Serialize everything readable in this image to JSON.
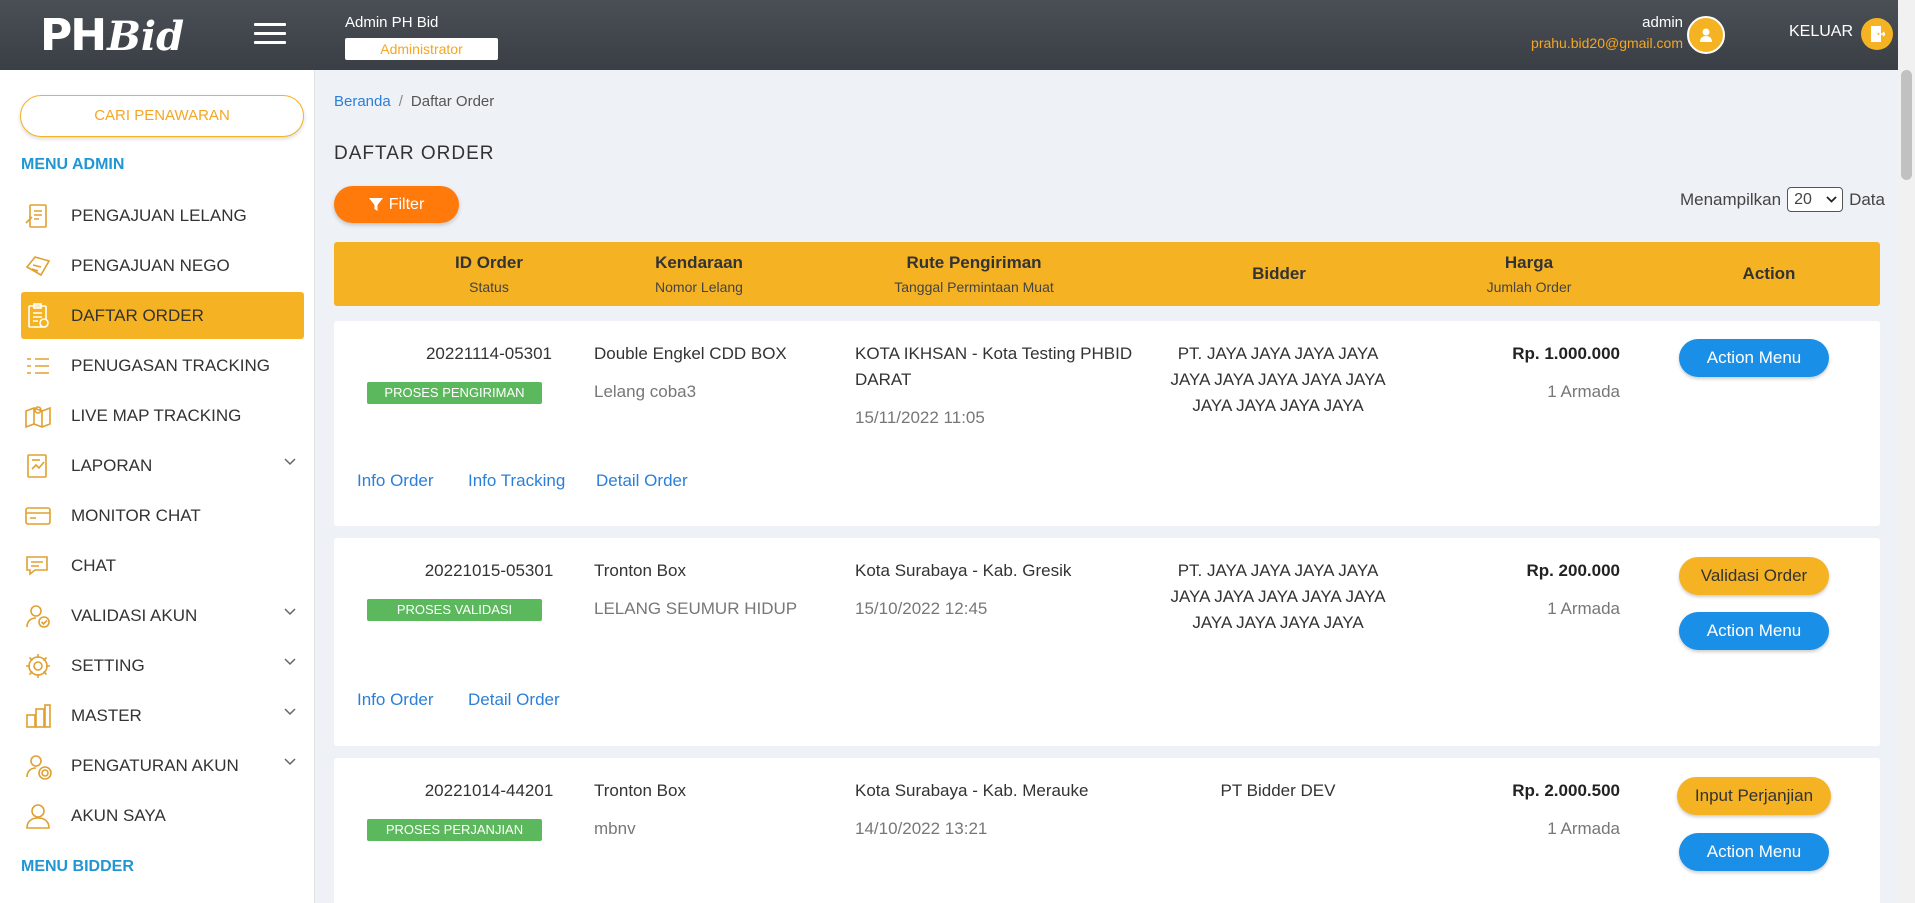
{
  "brand": {
    "logo_ph": "PH",
    "logo_bid": "Bid"
  },
  "header": {
    "admin_name": "Admin PH Bid",
    "role": "Administrator",
    "user_name": "admin",
    "user_email": "prahu.bid20@gmail.com",
    "logout_label": "KELUAR"
  },
  "sidebar": {
    "search_button": "CARI PENAWARAN",
    "menu_admin_title": "MENU ADMIN",
    "menu_bidder_title": "MENU BIDDER",
    "items": [
      {
        "label": "PENGAJUAN LELANG",
        "icon": "auction-request-icon"
      },
      {
        "label": "PENGAJUAN NEGO",
        "icon": "nego-request-icon"
      },
      {
        "label": "DAFTAR ORDER",
        "icon": "order-list-icon",
        "active": true
      },
      {
        "label": "PENUGASAN TRACKING",
        "icon": "tracking-assignment-icon"
      },
      {
        "label": "LIVE MAP TRACKING",
        "icon": "map-icon"
      },
      {
        "label": "LAPORAN",
        "icon": "report-icon",
        "expandable": true
      },
      {
        "label": "MONITOR CHAT",
        "icon": "monitor-chat-icon"
      },
      {
        "label": "CHAT",
        "icon": "chat-icon"
      },
      {
        "label": "VALIDASI AKUN",
        "icon": "account-validation-icon",
        "expandable": true
      },
      {
        "label": "SETTING",
        "icon": "gear-icon",
        "expandable": true
      },
      {
        "label": "MASTER",
        "icon": "master-data-icon",
        "expandable": true
      },
      {
        "label": "PENGATURAN AKUN",
        "icon": "account-settings-icon",
        "expandable": true
      },
      {
        "label": "AKUN SAYA",
        "icon": "user-icon"
      }
    ]
  },
  "breadcrumb": {
    "home": "Beranda",
    "separator": "/",
    "current": "Daftar Order"
  },
  "page_title": "DAFTAR ORDER",
  "filter_label": "Filter",
  "show": {
    "prefix": "Menampilkan",
    "value": "20",
    "suffix": "Data"
  },
  "table_head": {
    "col1": {
      "title": "ID Order",
      "sub": "Status"
    },
    "col2": {
      "title": "Kendaraan",
      "sub": "Nomor Lelang"
    },
    "col3": {
      "title": "Rute Pengiriman",
      "sub": "Tanggal Permintaan Muat"
    },
    "col4": {
      "title": "Bidder",
      "sub": ""
    },
    "col5": {
      "title": "Harga",
      "sub": "Jumlah Order"
    },
    "col6": {
      "title": "Action",
      "sub": ""
    }
  },
  "orders": [
    {
      "id": "20221114-05301",
      "status": "PROSES PENGIRIMAN",
      "vehicle": "Double Engkel CDD BOX",
      "auction_no": "Lelang coba3",
      "route_line1": "KOTA IKHSAN - Kota Testing PHBID",
      "route_line2": "DARAT",
      "date": "15/11/2022 11:05",
      "bidder_line1": "PT. JAYA JAYA JAYA JAYA",
      "bidder_line2": "JAYA JAYA JAYA JAYA JAYA",
      "bidder_line3": "JAYA JAYA JAYA JAYA",
      "price": "Rp. 1.000.000",
      "armada": "1 Armada",
      "action_button": "Action Menu",
      "links": [
        "Info Order",
        "Info Tracking",
        "Detail Order"
      ]
    },
    {
      "id": "20221015-05301",
      "status": "PROSES VALIDASI",
      "vehicle": "Tronton Box",
      "auction_no": "LELANG SEUMUR HIDUP",
      "route_line1": "Kota Surabaya - Kab. Gresik",
      "date": "15/10/2022 12:45",
      "bidder_line1": "PT. JAYA JAYA JAYA JAYA",
      "bidder_line2": "JAYA JAYA JAYA JAYA JAYA",
      "bidder_line3": "JAYA JAYA JAYA JAYA",
      "price": "Rp. 200.000",
      "armada": "1 Armada",
      "secondary_button": "Validasi Order",
      "action_button": "Action Menu",
      "links": [
        "Info Order",
        "Detail Order"
      ]
    },
    {
      "id": "20221014-44201",
      "status": "PROSES PERJANJIAN",
      "vehicle": "Tronton Box",
      "auction_no": "mbnv",
      "route_line1": "Kota Surabaya - Kab. Merauke",
      "date": "14/10/2022 13:21",
      "bidder_line1": "PT Bidder DEV",
      "price": "Rp. 2.000.500",
      "armada": "1 Armada",
      "secondary_button": "Input Perjanjian",
      "action_button": "Action Menu"
    }
  ],
  "colors": {
    "accent": "#f5b324",
    "header_bg": "#3f444a",
    "filter_orange": "#ff7a0a",
    "link_blue": "#2b7fd8",
    "button_blue": "#1a8fe8",
    "status_green": "#5cb85c"
  }
}
